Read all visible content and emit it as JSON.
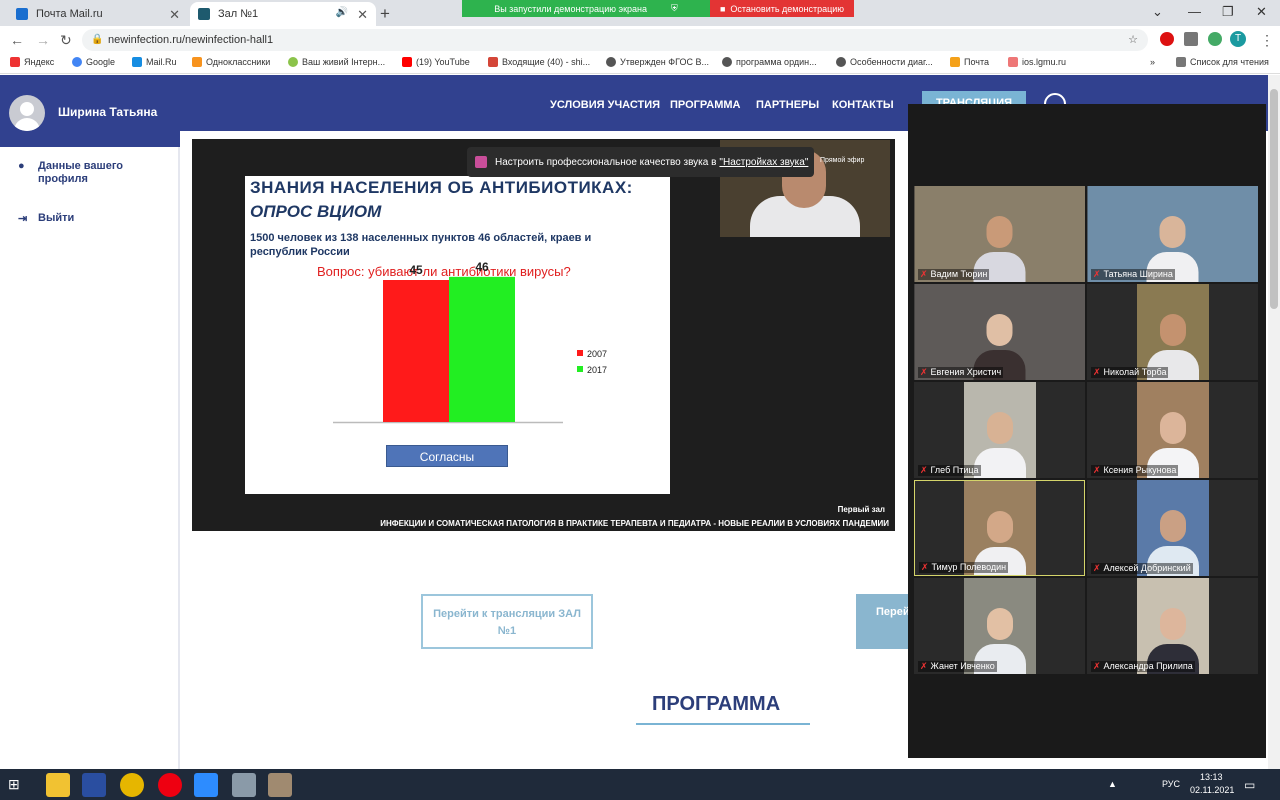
{
  "browser": {
    "tabs": [
      {
        "label": "Почта Mail.ru",
        "active": false
      },
      {
        "label": "Зал №1",
        "active": true
      }
    ],
    "share_notice": "Вы запустили демонстрацию экрана",
    "stop_share": "Остановить демонстрацию",
    "url": "newinfection.ru/newinfection-hall1",
    "bookmarks": [
      "Яндекс",
      "Google",
      "Mail.Ru",
      "Одноклассники",
      "Ваш живий Інтерн...",
      "(19) YouTube",
      "Входящие (40) - shi...",
      "Утвержден ФГОС В...",
      "программа ордин...",
      "Особенности диаг...",
      "Почта",
      "ios.lgmu.ru"
    ],
    "reading_list": "Список для чтения",
    "ext_avatar": "T"
  },
  "sidebar": {
    "user_name": "Ширина Татьяна",
    "items": [
      {
        "label": "Данные вашего профиля",
        "icon": "user-icon"
      },
      {
        "label": "Выйти",
        "icon": "logout-icon"
      }
    ]
  },
  "topnav": {
    "links": [
      "УСЛОВИЯ УЧАСТИЯ",
      "ПРОГРАММА",
      "ПАРТНЕРЫ",
      "КОНТАКТЫ"
    ],
    "broadcast_button": "ТРАНСЛЯЦИЯ"
  },
  "notification": {
    "text": "Настроить профессиональное качество звука в",
    "link": "\"Настройках звука\""
  },
  "video": {
    "live_label": "Прямой эфир",
    "hall_label": "Первый зал",
    "caption": "ИНФЕКЦИИ И СОМАТИЧЕСКАЯ ПАТОЛОГИЯ В ПРАКТИКЕ ТЕРАПЕВТА И ПЕДИАТРА - НОВЫЕ РЕАЛИИ В УСЛОВИЯХ ПАНДЕМИИ",
    "slide": {
      "title": "ЗНАНИЯ НАСЕЛЕНИЯ ОБ АНТИБИОТИКАХ:",
      "subtitle": "ОПРОС ВЦИОМ",
      "description": "1500 человек из 138 населенных пунктов 46 областей, краев и республик России",
      "question": "Вопрос: убивают ли антибиотики вирусы?",
      "button": "Согласны"
    }
  },
  "chart_data": {
    "type": "bar",
    "categories": [
      "Согласны"
    ],
    "series": [
      {
        "name": "2007",
        "values": [
          45
        ],
        "color": "#ff1a1a"
      },
      {
        "name": "2017",
        "values": [
          46
        ],
        "color": "#22ee22"
      }
    ],
    "ylim": [
      0,
      50
    ],
    "legend": "right"
  },
  "page": {
    "goto_button": "Перейти к трансляции ЗАЛ №1",
    "goto_button2": "Перей",
    "program_title": "ПРОГРАММА"
  },
  "participants": [
    {
      "name": "Вадим Тюрин",
      "skin": "#c99a78",
      "shirt": "#d8d8e0",
      "bg": "#8a7f6a"
    },
    {
      "name": "Татьяна Ширина",
      "skin": "#d9b59a",
      "shirt": "#f0f0f2",
      "bg": "#6f8ea8"
    },
    {
      "name": "Евгения Христич",
      "skin": "#e0bfa5",
      "shirt": "#3a3030",
      "bg": "#5e5a58"
    },
    {
      "name": "Николай Торба",
      "skin": "#c4926f",
      "shirt": "#e8e8ea",
      "bg": "#8a7a52"
    },
    {
      "name": "Глеб Птица",
      "skin": "#d8b294",
      "shirt": "#f2f2f4",
      "bg": "#b9b7ad"
    },
    {
      "name": "Ксения Рыкунова",
      "skin": "#dcb59a",
      "shirt": "#f4f4f6",
      "bg": "#a08060"
    },
    {
      "name": "Тимур Полеводин",
      "skin": "#d3a888",
      "shirt": "#f0f0f2",
      "bg": "#9a8060"
    },
    {
      "name": "Алексей Добринский",
      "skin": "#caa084",
      "shirt": "#dfe9f2",
      "bg": "#5a7aa8"
    },
    {
      "name": "Жанет Ивченко",
      "skin": "#e2c0a4",
      "shirt": "#e9ecf0",
      "bg": "#8a8a80"
    },
    {
      "name": "Александра Прилипа",
      "skin": "#ddb69c",
      "shirt": "#2e2e38",
      "bg": "#c8c0b0"
    }
  ],
  "taskbar": {
    "lang": "РУС",
    "time": "13:13",
    "date": "02.11.2021"
  }
}
